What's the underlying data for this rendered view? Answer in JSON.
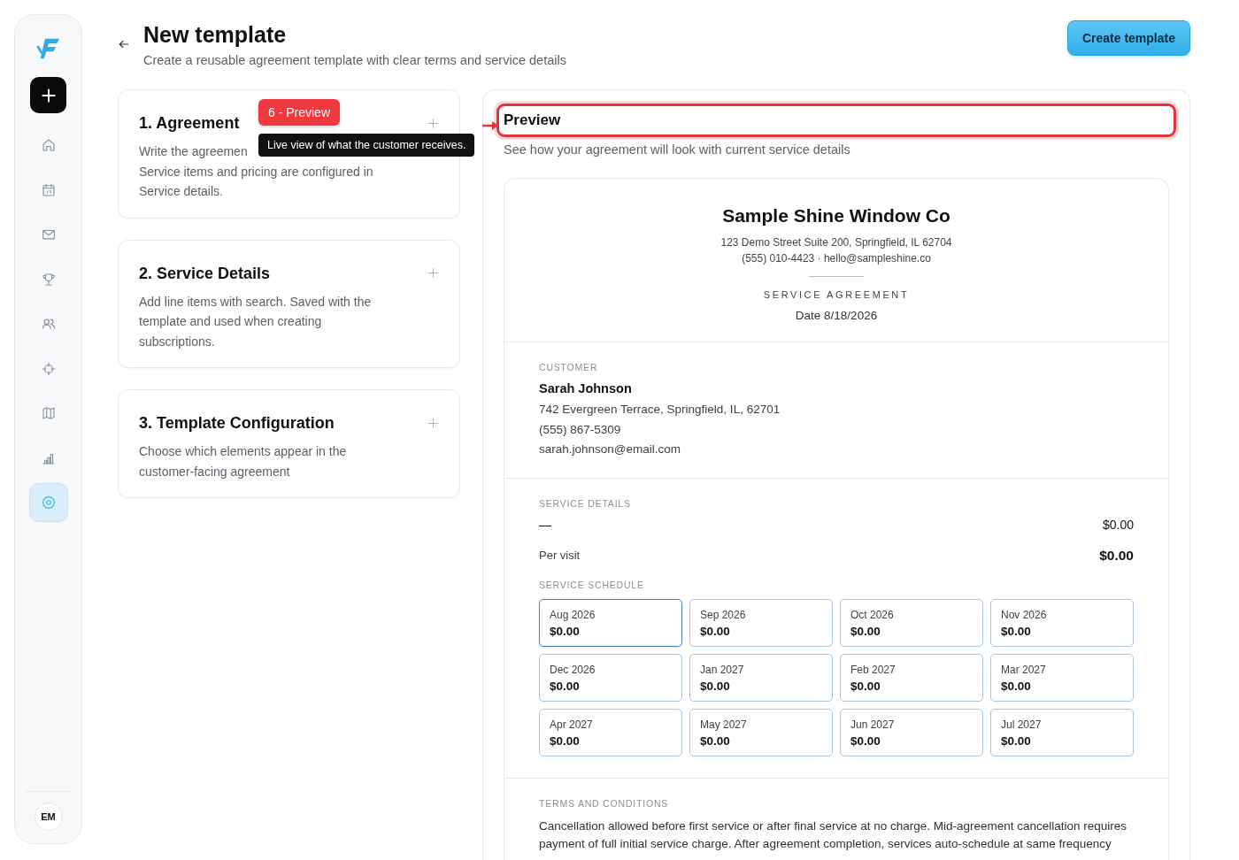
{
  "sidebar": {
    "items": [
      {
        "selected": false
      },
      {
        "selected": false
      },
      {
        "selected": false
      },
      {
        "selected": false
      },
      {
        "selected": false
      },
      {
        "selected": false
      },
      {
        "selected": false
      },
      {
        "selected": false
      },
      {
        "selected": true
      }
    ],
    "avatar": "EM"
  },
  "header": {
    "title": "New template",
    "subtitle": "Create a reusable agreement template with clear terms and service details",
    "create_button": "Create template"
  },
  "steps": [
    {
      "title": "1. Agreement",
      "description_lines": [
        "Write the agreemen",
        "Service items and pricing are configured in",
        "Service details."
      ]
    },
    {
      "title": "2. Service Details",
      "description_lines": [
        "Add line items with search. Saved with the",
        "template and used when creating",
        "subscriptions."
      ]
    },
    {
      "title": "3. Template Configuration",
      "description_lines": [
        "Choose which elements appear in the",
        "customer-facing agreement"
      ]
    }
  ],
  "tour": {
    "badge": "6 - Preview",
    "tooltip": "Live view of what the customer receives."
  },
  "preview": {
    "title": "Preview",
    "subtitle": "See how your agreement will look with current service details",
    "document": {
      "company": "Sample Shine Window Co",
      "address": "123 Demo Street Suite 200, Springfield, IL 62704",
      "contact": "(555) 010-4423 · hello@sampleshine.co",
      "doc_type": "SERVICE AGREEMENT",
      "date": "Date 8/18/2026",
      "customer": {
        "label": "CUSTOMER",
        "name": "Sarah Johnson",
        "address": "742 Evergreen Terrace, Springfield, IL, 62701",
        "phone": "(555) 867-5309",
        "email": "sarah.johnson@email.com"
      },
      "service": {
        "label": "SERVICE DETAILS",
        "line_items": [
          {
            "name": "—",
            "amount": "$0.00"
          }
        ],
        "total_label": "Per visit",
        "total": "$0.00",
        "schedule_label": "SERVICE SCHEDULE",
        "schedule": [
          {
            "month": "Aug 2026",
            "amount": "$0.00",
            "selected": true
          },
          {
            "month": "Sep 2026",
            "amount": "$0.00",
            "selected": false
          },
          {
            "month": "Oct 2026",
            "amount": "$0.00",
            "selected": false
          },
          {
            "month": "Nov 2026",
            "amount": "$0.00",
            "selected": false
          },
          {
            "month": "Dec 2026",
            "amount": "$0.00",
            "selected": false
          },
          {
            "month": "Jan 2027",
            "amount": "$0.00",
            "selected": false
          },
          {
            "month": "Feb 2027",
            "amount": "$0.00",
            "selected": false
          },
          {
            "month": "Mar 2027",
            "amount": "$0.00",
            "selected": false
          },
          {
            "month": "Apr 2027",
            "amount": "$0.00",
            "selected": false
          },
          {
            "month": "May 2027",
            "amount": "$0.00",
            "selected": false
          },
          {
            "month": "Jun 2027",
            "amount": "$0.00",
            "selected": false
          },
          {
            "month": "Jul 2027",
            "amount": "$0.00",
            "selected": false
          }
        ]
      },
      "terms": {
        "label": "TERMS AND CONDITIONS",
        "text": "Cancellation allowed before first service or after final service at no charge. Mid-agreement cancellation requires payment of full initial service charge. After agreement completion, services auto-schedule at same frequency"
      }
    }
  }
}
